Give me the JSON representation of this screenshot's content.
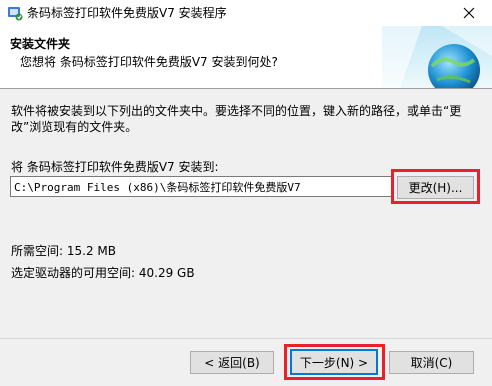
{
  "window": {
    "title": "条码标签打印软件免费版V7 安装程序",
    "icon": "installer-icon",
    "close_symbol": "✕"
  },
  "header": {
    "title": "安装文件夹",
    "subtitle": "您想将 条码标签打印软件免费版V7 安装到何处?"
  },
  "body": {
    "description": "软件将被安装到以下列出的文件夹中。要选择不同的位置，键入新的路径，或单击“更改”浏览现有的文件夹。",
    "dest_label": "将 条码标签打印软件免费版V7 安装到:",
    "install_path": "C:\\Program Files (x86)\\条码标签打印软件免费版V7",
    "change_button": "更改(H)...",
    "space_required": "所需空间: 15.2 MB",
    "space_available": "选定驱动器的可用空间: 40.29 GB"
  },
  "footer": {
    "back_button": "< 返回(B)",
    "next_button": "下一步(N) >",
    "cancel_button": "取消(C)"
  },
  "colors": {
    "highlight": "#e8212c",
    "focus_border": "#0078d7"
  }
}
